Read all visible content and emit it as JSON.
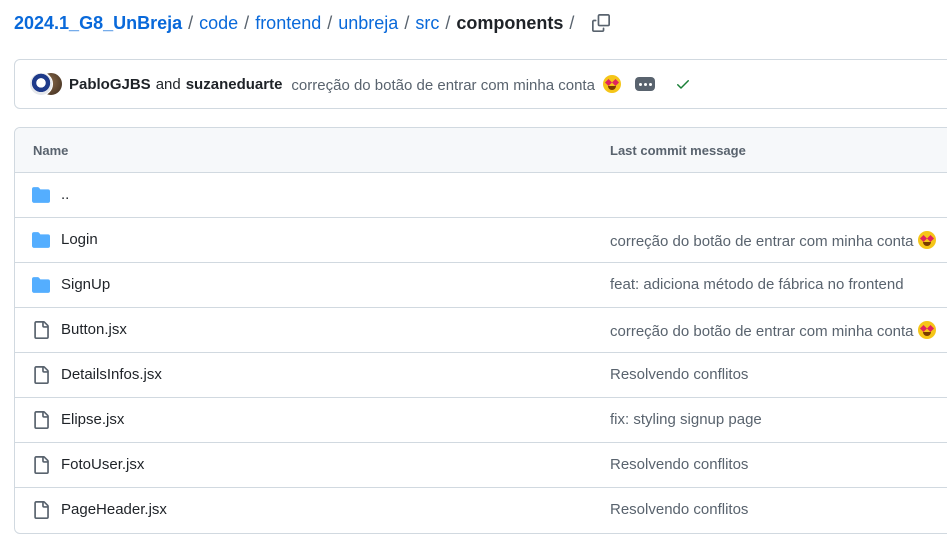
{
  "breadcrumb": {
    "repo": "2024.1_G8_UnBreja",
    "parts": [
      "code",
      "frontend",
      "unbreja",
      "src"
    ],
    "current": "components",
    "separator": "/"
  },
  "commit": {
    "author1": "PabloGJBS",
    "and": "and",
    "author2": "suzaneduarte",
    "message": "correção do botão de entrar com minha conta",
    "message_emoji": "star-struck-emoji",
    "status": "success"
  },
  "table": {
    "headers": {
      "name": "Name",
      "message": "Last commit message"
    },
    "rows": [
      {
        "name": "..",
        "type": "folder",
        "message": ""
      },
      {
        "name": "Login",
        "type": "folder",
        "message": "correção do botão de entrar com minha conta",
        "emoji": true
      },
      {
        "name": "SignUp",
        "type": "folder",
        "message": "feat: adiciona método de fábrica no frontend"
      },
      {
        "name": "Button.jsx",
        "type": "file",
        "message": "correção do botão de entrar com minha conta",
        "emoji": true
      },
      {
        "name": "DetailsInfos.jsx",
        "type": "file",
        "message": "Resolvendo conflitos"
      },
      {
        "name": "Elipse.jsx",
        "type": "file",
        "message": "fix: styling signup page"
      },
      {
        "name": "FotoUser.jsx",
        "type": "file",
        "message": "Resolvendo conflitos"
      },
      {
        "name": "PageHeader.jsx",
        "type": "file",
        "message": "Resolvendo conflitos"
      }
    ]
  },
  "colors": {
    "link": "#0969da",
    "folder": "#54aeff",
    "muted": "#59636e",
    "success": "#1a7f37",
    "border": "#d1d9e0"
  },
  "icons": {
    "copy": "copy-icon",
    "folder": "folder-icon",
    "file": "file-icon",
    "ellipsis": "ellipsis-icon",
    "check": "check-icon"
  }
}
